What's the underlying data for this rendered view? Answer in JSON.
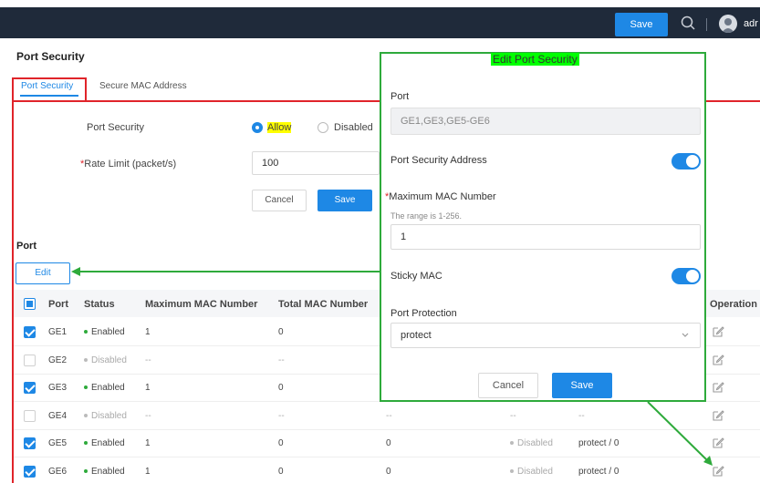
{
  "topbar": {
    "save_label": "Save",
    "user_label": "adr"
  },
  "page": {
    "title": "Port Security",
    "tabs": [
      "Port Security",
      "Secure MAC Address"
    ]
  },
  "form": {
    "port_security_label": "Port Security",
    "allow_label": "Allow",
    "disabled_label": "Disabled",
    "rate_limit_label": "Rate Limit (packet/s)",
    "rate_limit_value": "100",
    "cancel_label": "Cancel",
    "save_label": "Save"
  },
  "port_section": {
    "title": "Port",
    "edit_label": "Edit"
  },
  "table": {
    "headers": [
      "Port",
      "Status",
      "Maximum MAC Number",
      "Total MAC Number",
      "Operation"
    ],
    "rows": [
      {
        "checked": true,
        "port": "GE1",
        "status": "Enabled",
        "max": "1",
        "total": "0",
        "c5": "",
        "c6": "",
        "c7": ""
      },
      {
        "checked": false,
        "port": "GE2",
        "status": "Disabled",
        "max": "--",
        "total": "--",
        "c5": "",
        "c6": "",
        "c7": ""
      },
      {
        "checked": true,
        "port": "GE3",
        "status": "Enabled",
        "max": "1",
        "total": "0",
        "c5": "",
        "c6": "",
        "c7": ""
      },
      {
        "checked": false,
        "port": "GE4",
        "status": "Disabled",
        "max": "--",
        "total": "--",
        "c5": "--",
        "c6": "--",
        "c7": "--"
      },
      {
        "checked": true,
        "port": "GE5",
        "status": "Enabled",
        "max": "1",
        "total": "0",
        "c5": "0",
        "c6": "Disabled",
        "c7": "protect / 0"
      },
      {
        "checked": true,
        "port": "GE6",
        "status": "Enabled",
        "max": "1",
        "total": "0",
        "c5": "0",
        "c6": "Disabled",
        "c7": "protect / 0"
      }
    ]
  },
  "modal": {
    "title": "Edit Port Security",
    "port_label": "Port",
    "port_value": "GE1,GE3,GE5-GE6",
    "address_label": "Port Security Address",
    "address_on": true,
    "max_mac_label": "Maximum MAC Number",
    "max_mac_hint": "The range is 1-256.",
    "max_mac_value": "1",
    "sticky_label": "Sticky MAC",
    "sticky_on": true,
    "protection_label": "Port Protection",
    "protection_value": "protect",
    "cancel_label": "Cancel",
    "save_label": "Save"
  },
  "colors": {
    "accent": "#1e88e5",
    "annotation_red": "#e0242a",
    "annotation_green": "#2eaa3b",
    "enabled": "#2eaa3b",
    "topbar": "#1f2a3a"
  }
}
